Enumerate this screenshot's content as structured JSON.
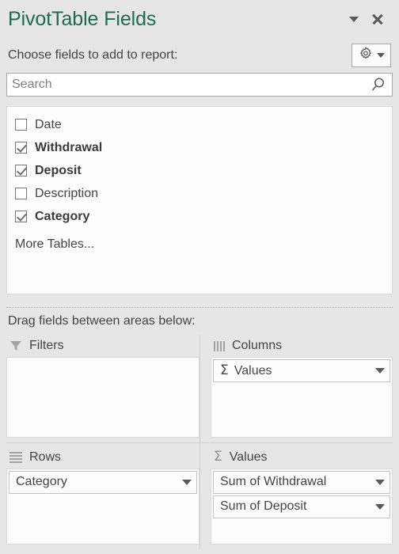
{
  "pane": {
    "title": "PivotTable Fields",
    "collapse_icon": "chevron-down-icon",
    "close_icon": "close-icon"
  },
  "chooser": {
    "label": "Choose fields to add to report:",
    "tools_icon": "gear-icon",
    "tools_caret_icon": "chevron-down-icon"
  },
  "search": {
    "value": "",
    "placeholder": "Search",
    "icon": "search-icon"
  },
  "field_list": {
    "items": [
      {
        "label": "Date",
        "checked": false
      },
      {
        "label": "Withdrawal",
        "checked": true
      },
      {
        "label": "Deposit",
        "checked": true
      },
      {
        "label": "Description",
        "checked": false
      },
      {
        "label": "Category",
        "checked": true
      }
    ],
    "more_tables_label": "More Tables..."
  },
  "areas_section": {
    "label": "Drag fields between areas below:",
    "filters": {
      "title": "Filters",
      "icon": "funnel-icon",
      "fields": []
    },
    "columns": {
      "title": "Columns",
      "icon": "columns-icon",
      "fields": [
        {
          "label": "Values",
          "sigma": "Σ",
          "caret_icon": "chevron-down-icon"
        }
      ]
    },
    "rows": {
      "title": "Rows",
      "icon": "rows-icon",
      "fields": [
        {
          "label": "Category",
          "sigma": "",
          "caret_icon": "chevron-down-icon"
        }
      ]
    },
    "values": {
      "title": "Values",
      "icon": "sigma-icon",
      "fields": [
        {
          "label": "Sum of Withdrawal",
          "sigma": "",
          "caret_icon": "chevron-down-icon"
        },
        {
          "label": "Sum of Deposit",
          "sigma": "",
          "caret_icon": "chevron-down-icon"
        }
      ]
    }
  },
  "colors": {
    "title": "#1e6b52",
    "pane_background": "#e6e6e6",
    "list_background": "#fcfcfc",
    "text": "#444444",
    "border": "#a6a6a6"
  }
}
